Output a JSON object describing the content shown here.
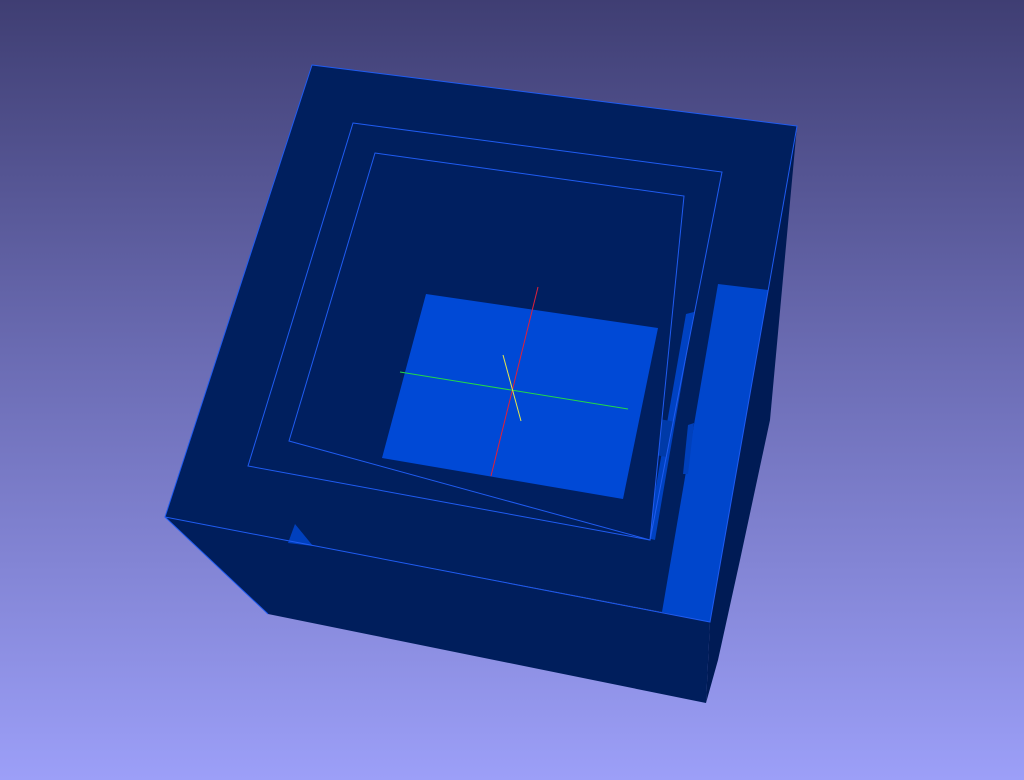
{
  "viewport": {
    "background_top": "#3f3e73",
    "background_bottom": "#9c9ff8"
  },
  "model": {
    "shade_dark": "#001e5c",
    "shade_mid": "#002a86",
    "shade_light": "#0049d6",
    "edge_color": "#1f5cf2"
  },
  "axes": {
    "x_color": "#e0203a",
    "y_color": "#22d84a",
    "z_color": "#e6e64a"
  }
}
